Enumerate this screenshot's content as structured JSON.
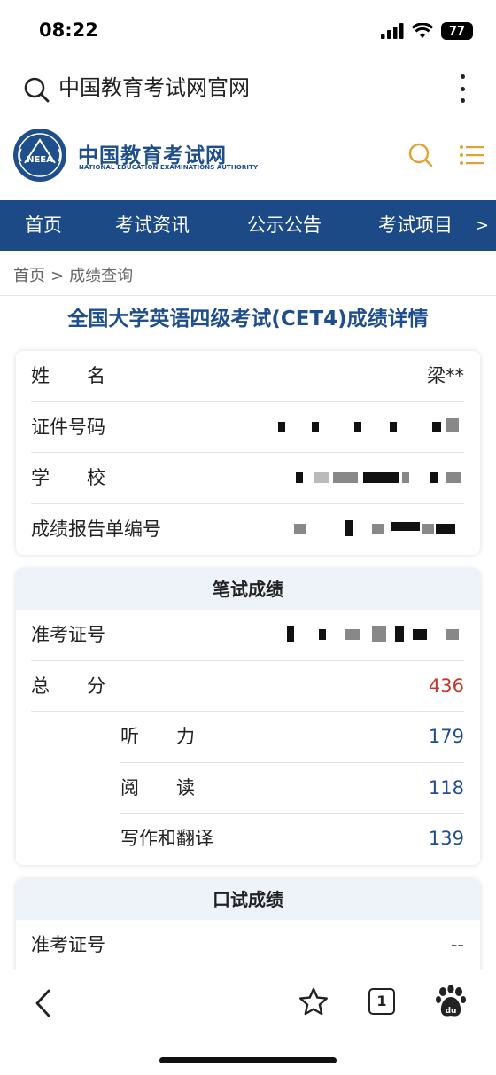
{
  "status": {
    "time": "08:22",
    "battery": "77"
  },
  "browser": {
    "title": "中国教育考试网官网"
  },
  "site": {
    "name_cn": "中国教育考试网",
    "name_en": "NATIONAL EDUCATION EXAMINATIONS AUTHORITY",
    "emblem_text": "NEEA"
  },
  "nav": {
    "items": [
      "首页",
      "考试资讯",
      "公示公告",
      "考试项目"
    ],
    "more": ">"
  },
  "breadcrumb": {
    "home": "首页",
    "sep": ">",
    "current": "成绩查询"
  },
  "page": {
    "title": "全国大学英语四级考试(CET4)成绩详情"
  },
  "info_card": {
    "name_label": "姓　　名",
    "name_value": "梁**",
    "id_label": "证件号码",
    "school_label": "学　　校",
    "report_label": "成绩报告单编号"
  },
  "written_card": {
    "header": "笔试成绩",
    "ticket_label": "准考证号",
    "total_label": "总　　分",
    "total_value": "436",
    "listening_label": "听　　力",
    "listening_value": "179",
    "reading_label": "阅　　读",
    "reading_value": "118",
    "writing_label": "写作和翻译",
    "writing_value": "139"
  },
  "oral_card": {
    "header": "口试成绩",
    "ticket_label": "准考证号",
    "ticket_value": "--"
  },
  "toolbar": {
    "tabs_count": "1"
  },
  "colors": {
    "brand_blue": "#1c4a86",
    "score_red": "#c0392b",
    "logo_gold": "#e0a330"
  }
}
